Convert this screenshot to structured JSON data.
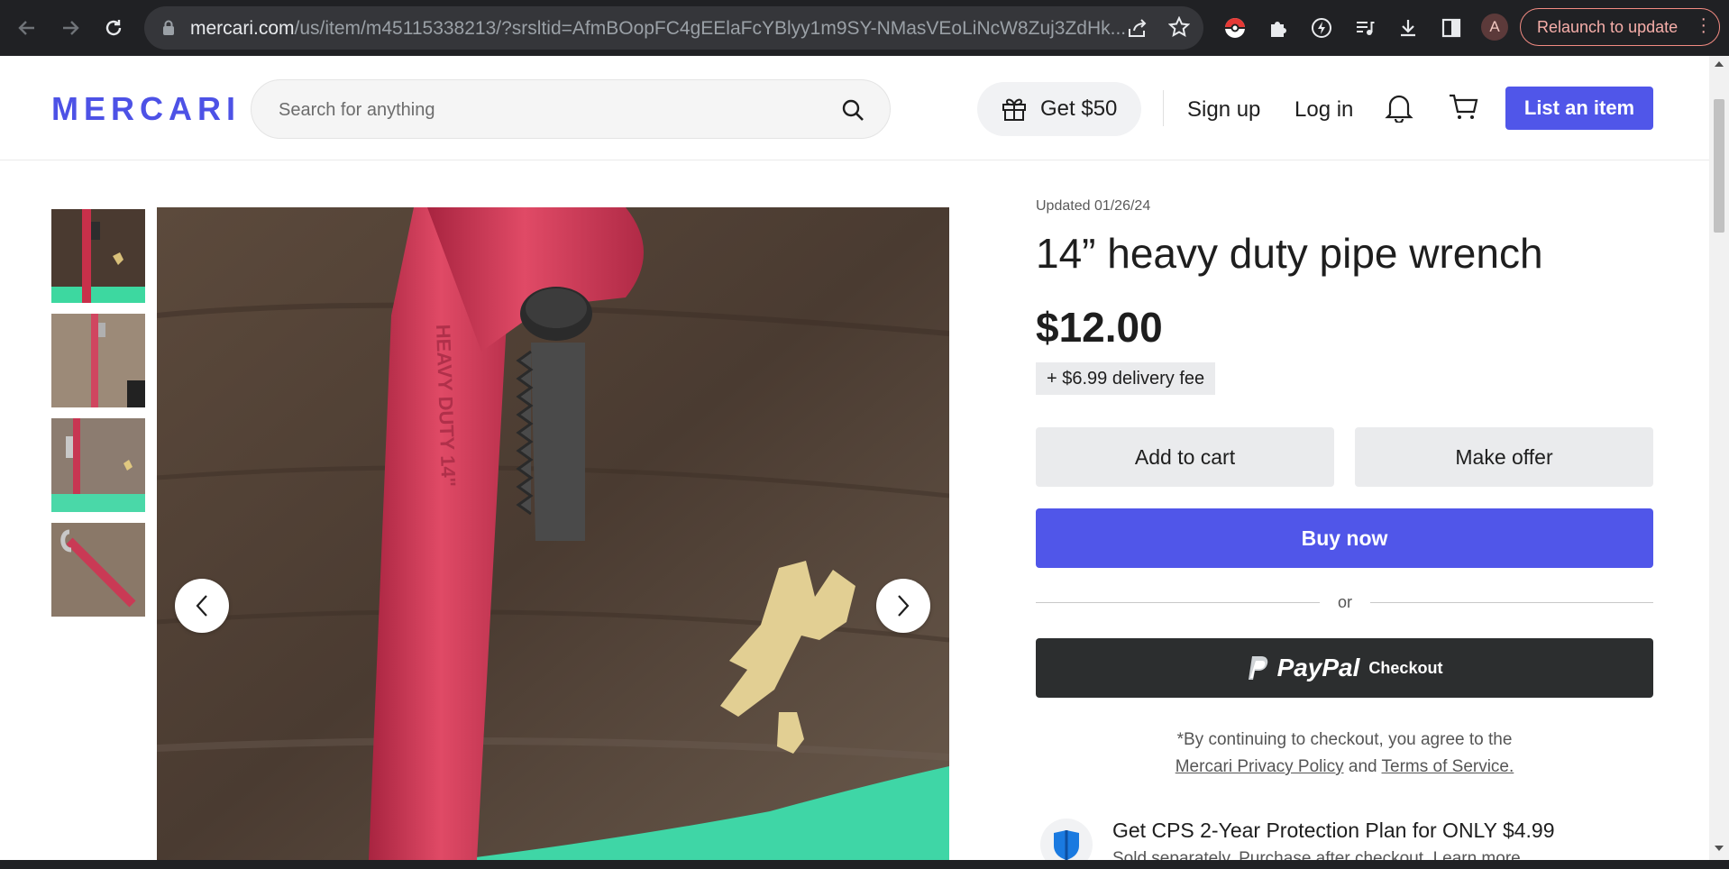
{
  "browser": {
    "url_host": "mercari.com",
    "url_path": "/us/item/m45115338213/?srsltid=AfmBOopFC4gEElaFcYBlyy1m9SY-NMasVEoLiNcW8Zuj3ZdHk...",
    "profile_initial": "A",
    "relaunch_label": "Relaunch to update",
    "icons": [
      "back-icon",
      "forward-icon",
      "reload-icon",
      "lock-icon",
      "share-icon",
      "star-icon",
      "pokeball-extension-icon",
      "puzzle-icon",
      "performance-icon",
      "media-icon",
      "download-icon",
      "side-panel-icon",
      "more-vert-icon"
    ]
  },
  "header": {
    "logo": "MERCARI",
    "search_placeholder": "Search for anything",
    "get50_label": "Get $50",
    "signup_label": "Sign up",
    "login_label": "Log in",
    "list_item_label": "List an item",
    "brand_color": "#4d52e6"
  },
  "gallery": {
    "thumbnail_count": 4,
    "active_index": 0
  },
  "item": {
    "updated": "Updated 01/26/24",
    "title": "14” heavy duty pipe wrench",
    "price": "$12.00",
    "delivery_fee": "+ $6.99 delivery fee",
    "add_to_cart_label": "Add to cart",
    "make_offer_label": "Make offer",
    "buy_now_label": "Buy now",
    "or_label": "or",
    "paypal_word": "PayPal",
    "paypal_checkout": "Checkout",
    "terms_prefix": "*By continuing to checkout, you agree to the",
    "privacy_link": "Mercari Privacy Policy",
    "terms_and": "and",
    "terms_link": "Terms of Service.",
    "cps_title": "Get CPS 2-Year Protection Plan for ONLY $4.99",
    "cps_sub": "Sold separately. Purchase after checkout. Learn more"
  }
}
